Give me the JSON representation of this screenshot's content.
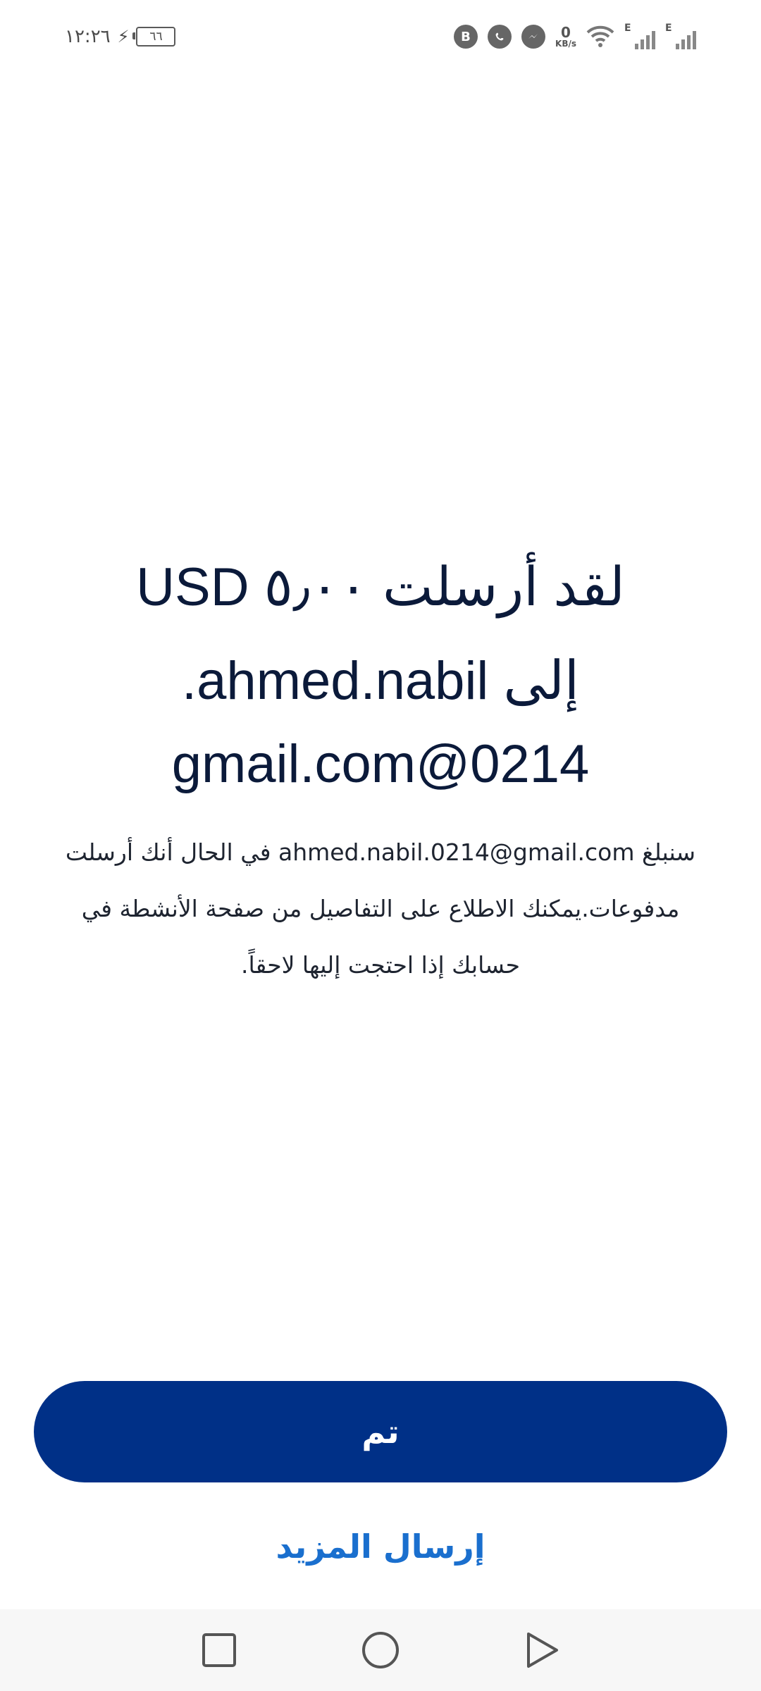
{
  "status_bar": {
    "time": "١٢:٢٦",
    "battery": "٦٦",
    "data_speed_value": "0",
    "data_speed_unit": "KB/s",
    "network_label_1": "E",
    "network_label_2": "E",
    "icons": [
      "bbm-icon",
      "whatsapp-icon",
      "messenger-icon",
      "wifi-icon",
      "signal-icon",
      "signal-icon"
    ]
  },
  "confirmation": {
    "headline_line1": "لقد أرسلت ٥٫٠٠ USD",
    "headline_line2": "إلى ahmed.nabil.",
    "headline_line3": "0214@gmail.com",
    "body": "سنبلغ ahmed.nabil.0214@gmail.com في الحال أنك أرسلت مدفوعات.يمكنك الاطلاع على التفاصيل من صفحة الأنشطة في حسابك إذا احتجت إليها لاحقاً."
  },
  "actions": {
    "done_label": "تم",
    "send_more_label": "إرسال المزيد"
  },
  "colors": {
    "primary_button": "#003087",
    "link": "#1a6fce",
    "text": "#0b1a3a"
  }
}
